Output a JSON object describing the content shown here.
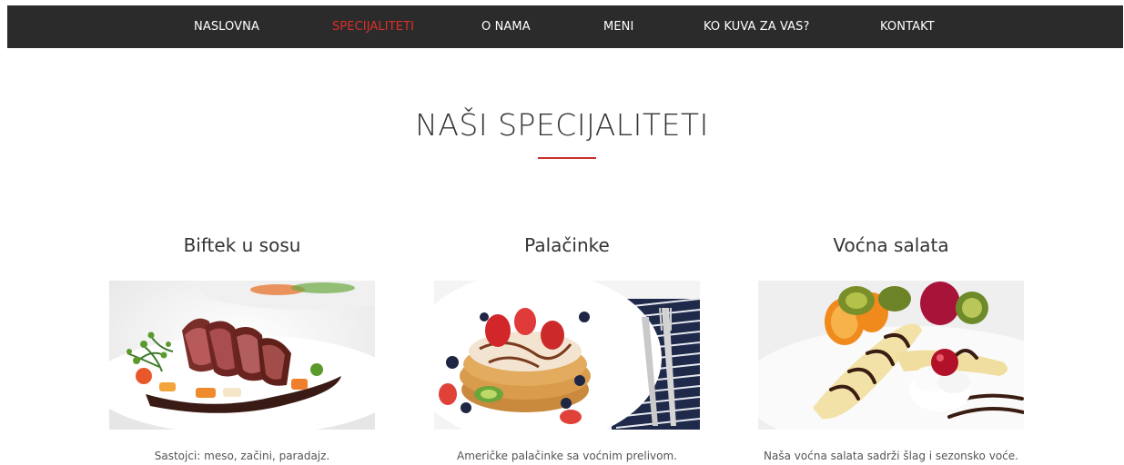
{
  "nav": {
    "items": [
      {
        "label": "NASLOVNA"
      },
      {
        "label": "SPECIJALITETI"
      },
      {
        "label": "O NAMA"
      },
      {
        "label": "MENI"
      },
      {
        "label": "KO KUVA ZA VAS?"
      },
      {
        "label": "KONTAKT"
      }
    ],
    "active_color": "#d9302b",
    "background": "#2b2b2b"
  },
  "section": {
    "title": "NAŠI SPECIJALITETI",
    "accent_color": "#c9302c"
  },
  "specialties": [
    {
      "title": "Biftek u sosu",
      "description": "Sastojci: meso, začini, paradajz."
    },
    {
      "title": "Palačinke",
      "description": "Američke palačinke sa voćnim prelivom."
    },
    {
      "title": "Voćna salata",
      "description": "Naša voćna salata sadrži šlag i sezonsko voće."
    }
  ]
}
